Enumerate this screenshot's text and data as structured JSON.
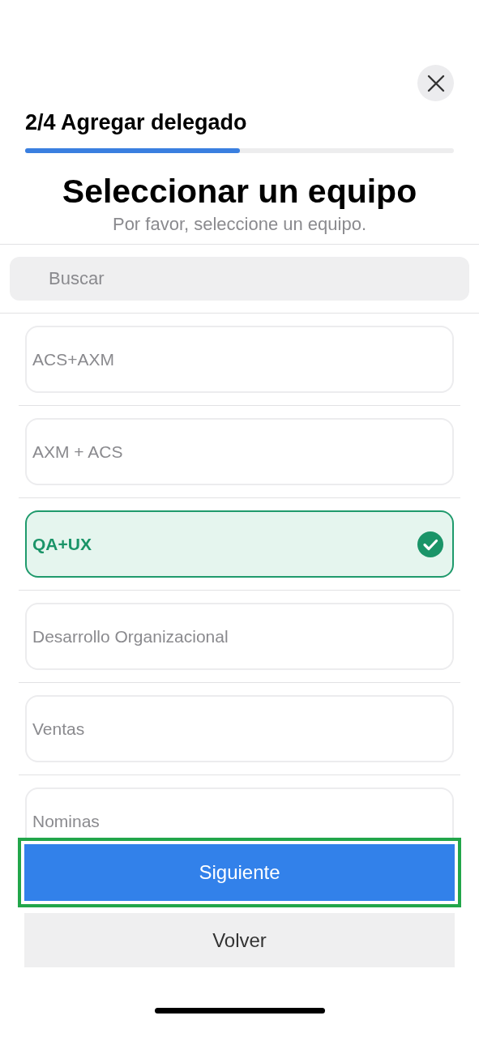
{
  "step_title": "2/4 Agregar delegado",
  "progress": {
    "level": 0.5
  },
  "heading": "Seleccionar un equipo",
  "subtitle": "Por favor, seleccione un equipo.",
  "search": {
    "placeholder": "Buscar"
  },
  "teams": [
    {
      "label": "ACS+AXM",
      "selected": false
    },
    {
      "label": "AXM + ACS",
      "selected": false
    },
    {
      "label": "QA+UX",
      "selected": true
    },
    {
      "label": "Desarrollo Organizacional",
      "selected": false
    },
    {
      "label": "Ventas",
      "selected": false
    },
    {
      "label": "Nominas",
      "selected": false
    }
  ],
  "buttons": [
    {
      "label": "Siguiente",
      "kind": "primary",
      "highlighted": true
    },
    {
      "label": "Volver",
      "kind": "secondary",
      "highlighted": false
    }
  ]
}
